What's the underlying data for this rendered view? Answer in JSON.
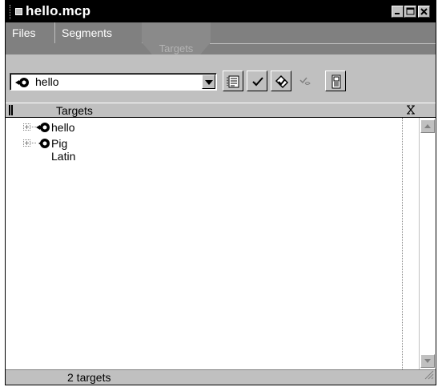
{
  "window": {
    "title": "hello.mcp",
    "controls": [
      "minimize",
      "maximize",
      "close"
    ]
  },
  "tabs": [
    {
      "label": "Files",
      "active": false
    },
    {
      "label": "Segments",
      "active": false
    },
    {
      "label": "Targets",
      "active": true
    }
  ],
  "toolbar": {
    "target_select_value": "hello",
    "buttons": [
      {
        "icon": "target-settings-icon"
      },
      {
        "icon": "check-syntax-icon"
      },
      {
        "icon": "make-icon"
      },
      {
        "icon": "debug-icon"
      },
      {
        "icon": "project-info-icon"
      }
    ]
  },
  "list_header": {
    "title": "Targets"
  },
  "targets": [
    {
      "label": "hello",
      "icon": "target-icon"
    },
    {
      "label": "Pig Latin",
      "icon": "target-icon"
    }
  ],
  "status": {
    "text": "2 targets"
  },
  "colors": {
    "window_bg": "#c0c0c0",
    "titlebar": "#000000",
    "tabstrip": "#808080"
  }
}
